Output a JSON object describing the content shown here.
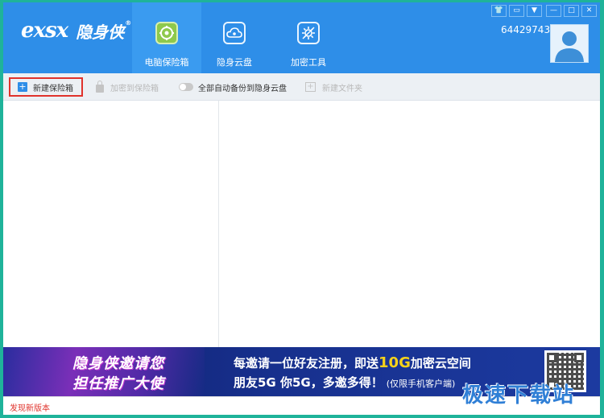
{
  "app": {
    "logo_mark": "exsx",
    "logo_mark_sub": "XSX",
    "logo_text": "隐身侠",
    "logo_reg": "®"
  },
  "nav": {
    "tabs": [
      {
        "label": "电脑保险箱",
        "icon": "safe-icon",
        "active": true
      },
      {
        "label": "隐身云盘",
        "icon": "cloud-icon",
        "active": false
      },
      {
        "label": "加密工具",
        "icon": "tools-icon",
        "active": false
      }
    ]
  },
  "window_controls": [
    {
      "name": "skin-icon",
      "glyph": "👕"
    },
    {
      "name": "message-icon",
      "glyph": "▭"
    },
    {
      "name": "menu-icon",
      "glyph": "▼"
    },
    {
      "name": "minimize-icon",
      "glyph": "—"
    },
    {
      "name": "maximize-icon",
      "glyph": "□"
    },
    {
      "name": "close-icon",
      "glyph": "✕"
    }
  ],
  "user": {
    "id": "64429743"
  },
  "toolbar": {
    "new_vault_label": "新建保险箱",
    "encrypt_to_vault_label": "加密到保险箱",
    "auto_backup_label": "全部自动备份到隐身云盘",
    "new_folder_label": "新建文件夹",
    "auto_backup_on": false
  },
  "banner": {
    "left_line1": "隐身侠邀请您",
    "left_line2": "担任推广大使",
    "line1_prefix": "每邀请一位好友注册，即送",
    "line1_highlight": "10G",
    "line1_suffix": "加密云空间",
    "line2_main": "朋友5G  你5G，多邀多得！",
    "line2_note": "(仅限手机客户端)"
  },
  "status": {
    "text": "发现新版本"
  },
  "watermark": {
    "text": "极速下载站"
  },
  "colors": {
    "header": "#2e8ee8",
    "active_tab": "#3a9bf0",
    "toolbar": "#ecf0f4",
    "highlight_border": "#e0332c",
    "frame": "#1fb39a"
  }
}
